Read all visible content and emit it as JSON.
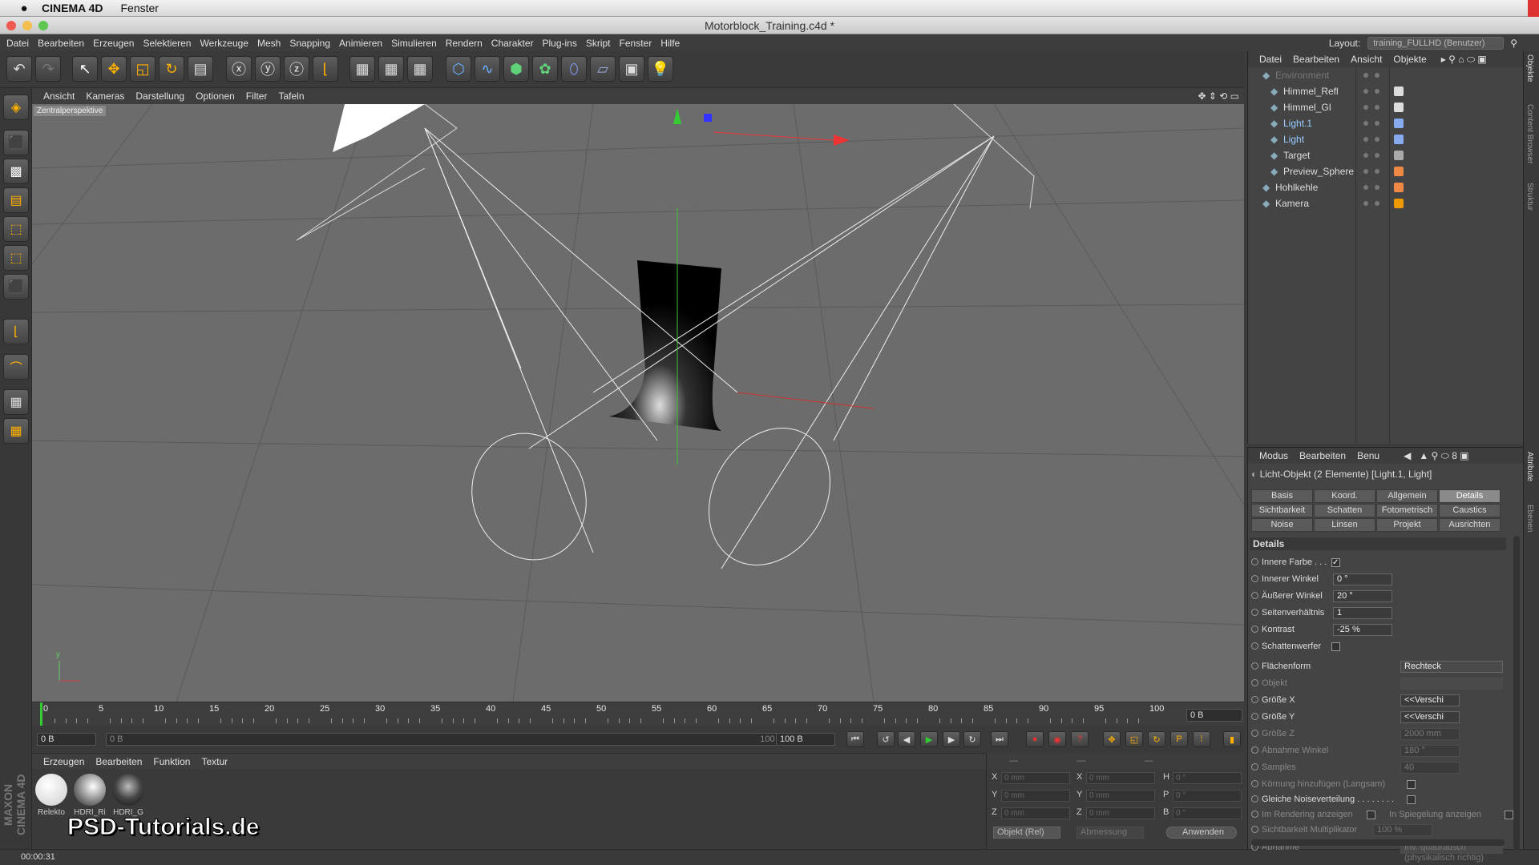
{
  "mac_menu": {
    "app": "CINEMA 4D",
    "items": [
      "Fenster"
    ]
  },
  "window": {
    "title": "Motorblock_Training.c4d *"
  },
  "main_menu": [
    "Datei",
    "Bearbeiten",
    "Erzeugen",
    "Selektieren",
    "Werkzeuge",
    "Mesh",
    "Snapping",
    "Animieren",
    "Simulieren",
    "Rendern",
    "Charakter",
    "Plug-ins",
    "Skript",
    "Fenster",
    "Hilfe"
  ],
  "layout": {
    "label": "Layout:",
    "value": "training_FULLHD (Benutzer)"
  },
  "viewport": {
    "menu": [
      "Ansicht",
      "Kameras",
      "Darstellung",
      "Optionen",
      "Filter",
      "Tafeln"
    ],
    "label": "Zentralperspektive"
  },
  "timeline": {
    "ticks": [
      "0",
      "5",
      "10",
      "15",
      "20",
      "25",
      "30",
      "35",
      "40",
      "45",
      "50",
      "55",
      "60",
      "65",
      "70",
      "75",
      "80",
      "85",
      "90",
      "95",
      "100"
    ],
    "current": "0 B",
    "start": "0 B",
    "range_start": "0 B",
    "range_end": "100 B",
    "end": "100 B"
  },
  "materials": {
    "menu": [
      "Erzeugen",
      "Bearbeiten",
      "Funktion",
      "Textur"
    ],
    "items": [
      {
        "name": "Relekto",
        "color": "#f2f2f2"
      },
      {
        "name": "HDRI_Ri",
        "color": "#d8d8d8"
      },
      {
        "name": "HDRI_G",
        "color": "#555"
      }
    ]
  },
  "coords": {
    "rows": [
      {
        "a": "X",
        "av": "0 mm",
        "b": "X",
        "bv": "0 mm",
        "c": "H",
        "cv": "0 °"
      },
      {
        "a": "Y",
        "av": "0 mm",
        "b": "Y",
        "bv": "0 mm",
        "c": "P",
        "cv": "0 °"
      },
      {
        "a": "Z",
        "av": "0 mm",
        "b": "Z",
        "bv": "0 mm",
        "c": "B",
        "cv": "0 °"
      }
    ],
    "mode": "Objekt (Rel)",
    "size_mode": "Abmessung",
    "apply": "Anwenden"
  },
  "status": {
    "time": "00:00:31"
  },
  "watermark": "PSD-Tutorials.de",
  "objects": {
    "menu": [
      "Datei",
      "Bearbeiten",
      "Ansicht",
      "Objekte"
    ],
    "items": [
      {
        "name": "Environment",
        "indent": 0,
        "dim": true
      },
      {
        "name": "Himmel_Refl",
        "indent": 1,
        "dim": false
      },
      {
        "name": "Himmel_GI",
        "indent": 1,
        "dim": false
      },
      {
        "name": "Light.1",
        "indent": 1,
        "dim": false
      },
      {
        "name": "Light",
        "indent": 1,
        "dim": false
      },
      {
        "name": "Target",
        "indent": 1,
        "dim": false
      },
      {
        "name": "Preview_Sphere",
        "indent": 1,
        "dim": false
      },
      {
        "name": "Hohlkehle",
        "indent": 0,
        "dim": false
      },
      {
        "name": "Kamera",
        "indent": 0,
        "dim": false
      }
    ]
  },
  "attributes": {
    "menu": [
      "Modus",
      "Bearbeiten",
      "Benu"
    ],
    "title": "Licht-Objekt (2 Elemente) [Light.1, Light]",
    "tabs": [
      "Basis",
      "Koord.",
      "Allgemein",
      "Details",
      "Sichtbarkeit",
      "Schatten",
      "Fotometrisch",
      "Caustics",
      "Noise",
      "Linsen",
      "Projekt",
      "Ausrichten"
    ],
    "active_tab": "Details",
    "section": "Details",
    "fields": [
      {
        "label": "Innere Farbe . . .",
        "type": "check",
        "checked": true
      },
      {
        "label": "Innerer Winkel",
        "type": "num",
        "value": "0 °"
      },
      {
        "label": "Äußerer Winkel",
        "type": "num",
        "value": "20 °"
      },
      {
        "label": "Seitenverhältnis",
        "type": "num",
        "value": "1"
      },
      {
        "label": "Kontrast",
        "type": "num",
        "value": "-25 %"
      },
      {
        "label": "Schattenwerfer",
        "type": "check",
        "checked": false
      },
      {
        "label": "Flächenform",
        "type": "select",
        "value": "Rechteck"
      },
      {
        "label": "Objekt",
        "type": "empty",
        "value": "",
        "dim": true
      },
      {
        "label": "Größe X",
        "type": "small",
        "value": "<<Verschi"
      },
      {
        "label": "Größe Y",
        "type": "small",
        "value": "<<Verschi"
      },
      {
        "label": "Größe Z",
        "type": "small",
        "value": "2000 mm",
        "dim": true
      },
      {
        "label": "Abnahme Winkel",
        "type": "small",
        "value": "180 °",
        "dim": true
      },
      {
        "label": "Samples",
        "type": "small",
        "value": "40",
        "dim": true
      },
      {
        "label": "Körnung hinzufügen (Langsam)",
        "type": "check",
        "checked": false,
        "dim": true
      },
      {
        "label": "Gleiche Noiseverteilung . . . . . . . .",
        "type": "check",
        "checked": false
      },
      {
        "label": "Im Rendering anzeigen",
        "type": "check2",
        "label2": "In Spiegelung anzeigen",
        "dim": true
      },
      {
        "label": "Sichtbarkeit Multiplikator",
        "type": "small",
        "value": "100 %",
        "dim": true
      },
      {
        "label": "Abnahme",
        "type": "select",
        "value": "Inv. quadratisch (physikalisch richtig)",
        "dim": true
      }
    ]
  },
  "side_tabs": [
    "Objekte",
    "Content Browser",
    "Struktur",
    "Attribute",
    "Ebenen"
  ]
}
